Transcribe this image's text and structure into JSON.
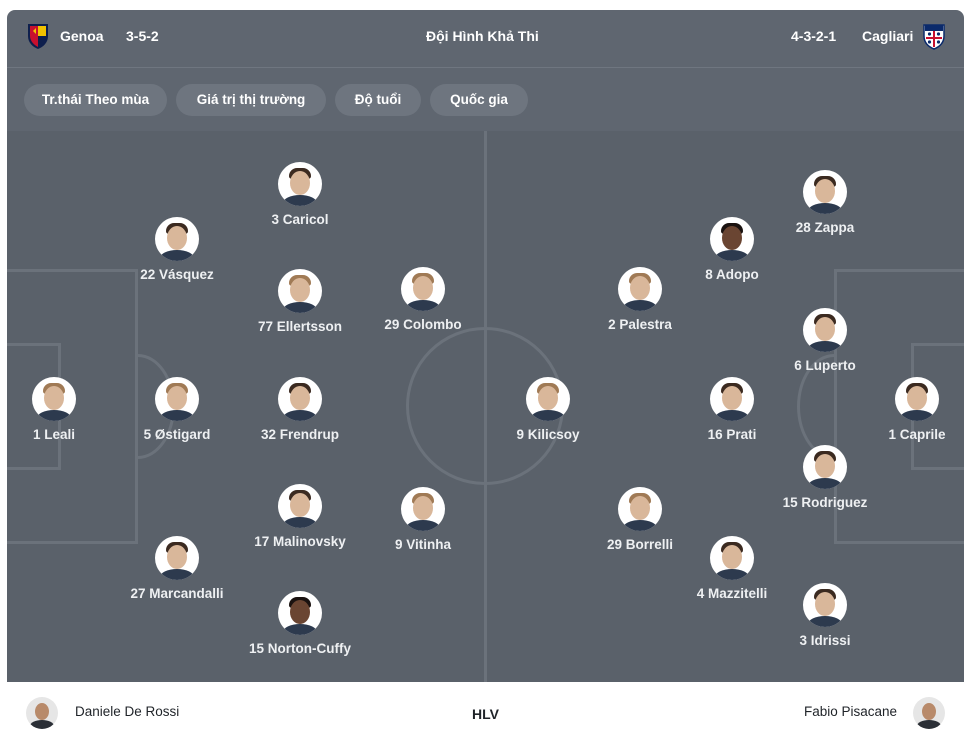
{
  "header": {
    "home_team": "Genoa",
    "home_formation": "3-5-2",
    "title": "Đội Hình Khả Thi",
    "away_formation": "4-3-2-1",
    "away_team": "Cagliari"
  },
  "filters": [
    "Tr.thái Theo mùa",
    "Giá trị thị trường",
    "Độ tuổi",
    "Quốc gia"
  ],
  "home_players": [
    {
      "label": "1 Leali"
    },
    {
      "label": "22 Vásquez"
    },
    {
      "label": "5 Østigard"
    },
    {
      "label": "27 Marcandalli"
    },
    {
      "label": "3 Caricol"
    },
    {
      "label": "77 Ellertsson"
    },
    {
      "label": "32 Frendrup"
    },
    {
      "label": "17 Malinovsky"
    },
    {
      "label": "15 Norton-Cuffy"
    },
    {
      "label": "29 Colombo"
    },
    {
      "label": "9 Vitinha"
    }
  ],
  "away_players": [
    {
      "label": "1 Caprile"
    },
    {
      "label": "28 Zappa"
    },
    {
      "label": "6 Luperto"
    },
    {
      "label": "15 Rodriguez"
    },
    {
      "label": "3 Idrissi"
    },
    {
      "label": "8 Adopo"
    },
    {
      "label": "16 Prati"
    },
    {
      "label": "4 Mazzitelli"
    },
    {
      "label": "2 Palestra"
    },
    {
      "label": "29 Borrelli"
    },
    {
      "label": "9 Kilicsoy"
    }
  ],
  "footer": {
    "home_coach": "Daniele De Rossi",
    "label": "HLV",
    "away_coach": "Fabio Pisacane"
  },
  "colors": {
    "header_bg": "#5f6670",
    "pitch_bg": "#5a616a",
    "genoa_red": "#c8102e",
    "genoa_blue": "#0e1f4d",
    "cagliari_blue": "#0b2a6b",
    "cagliari_red": "#c8102e"
  },
  "icons": {
    "home_crest": "genoa-crest-icon",
    "away_crest": "cagliari-crest-icon"
  }
}
